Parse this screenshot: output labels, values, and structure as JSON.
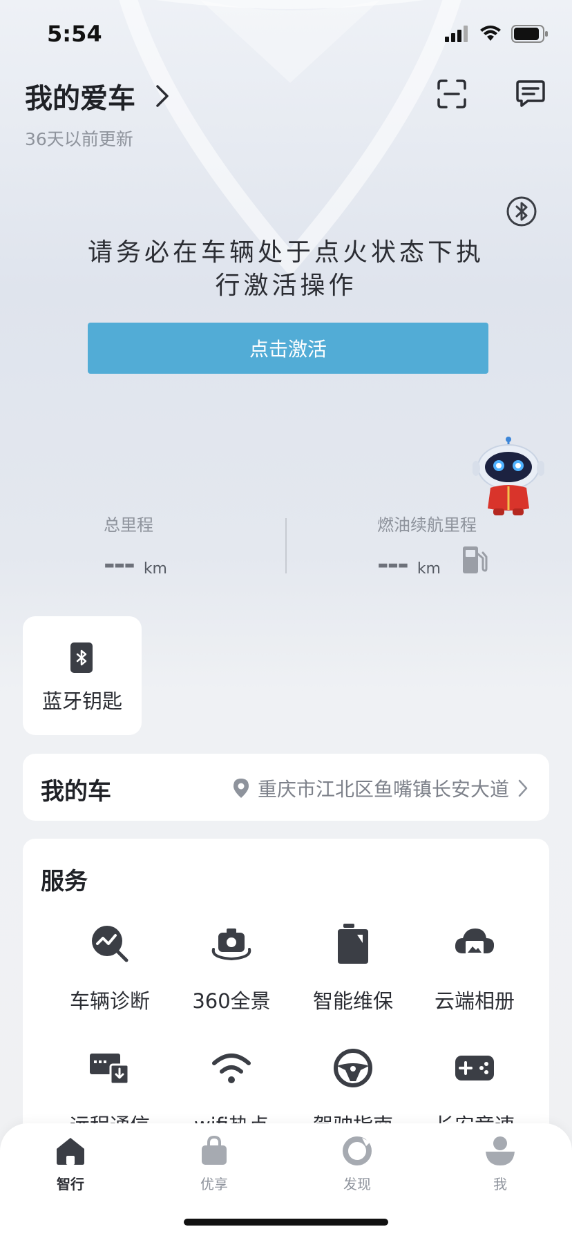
{
  "status_bar": {
    "time": "5:54"
  },
  "header": {
    "title": "我的爱车",
    "subtitle": "36天以前更新",
    "icons": [
      "chevron-right-icon",
      "scan-icon",
      "message-icon"
    ]
  },
  "activation": {
    "notice": "请务必在车辆处于点火状态下执行激活操作",
    "button_label": "点击激活"
  },
  "mileage": {
    "total": {
      "label": "总里程",
      "value": "---",
      "unit": "km"
    },
    "fuel_range": {
      "label": "燃油续航里程",
      "value": "---",
      "unit": "km"
    }
  },
  "bluetooth_key": {
    "label": "蓝牙钥匙"
  },
  "my_car": {
    "title": "我的车",
    "location": "重庆市江北区鱼嘴镇长安大道"
  },
  "services": {
    "title": "服务",
    "items": [
      {
        "label": "车辆诊断",
        "icon": "diagnosis-icon"
      },
      {
        "label": "360全景",
        "icon": "panorama-camera-icon"
      },
      {
        "label": "智能维保",
        "icon": "maintenance-icon"
      },
      {
        "label": "云端相册",
        "icon": "cloud-album-icon"
      },
      {
        "label": "远程通信",
        "icon": "remote-communication-icon"
      },
      {
        "label": "wifi热点",
        "icon": "wifi-hotspot-icon"
      },
      {
        "label": "驾驶指南",
        "icon": "steering-wheel-icon"
      },
      {
        "label": "长安竞速",
        "icon": "gamepad-icon"
      }
    ]
  },
  "tabs": [
    {
      "label": "智行",
      "icon": "home-icon",
      "active": true
    },
    {
      "label": "优享",
      "icon": "bag-icon",
      "active": false
    },
    {
      "label": "发现",
      "icon": "discover-icon",
      "active": false
    },
    {
      "label": "我",
      "icon": "profile-icon",
      "active": false
    }
  ],
  "colors": {
    "accent": "#52acd6",
    "icon_dark": "#3b3e45",
    "text_muted": "#8e939c"
  }
}
